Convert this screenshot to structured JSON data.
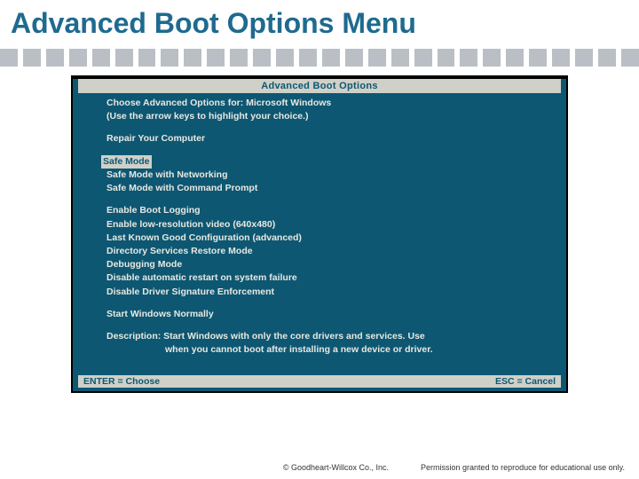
{
  "slide": {
    "title": "Advanced Boot Options Menu"
  },
  "boot": {
    "header": "Advanced Boot Options",
    "choose_line1": "Choose Advanced Options for: Microsoft Windows",
    "choose_line2": "(Use the arrow keys to highlight your choice.)",
    "repair": "Repair Your Computer",
    "opt_safe": "Safe Mode",
    "opt_safe_net": "Safe Mode with Networking",
    "opt_safe_cmd": "Safe Mode with Command Prompt",
    "opt_logging": "Enable Boot Logging",
    "opt_lowres": "Enable low-resolution video (640x480)",
    "opt_lkg": "Last Known Good Configuration (advanced)",
    "opt_dsrm": "Directory Services Restore Mode",
    "opt_debug": "Debugging Mode",
    "opt_norestart": "Disable automatic restart on system failure",
    "opt_nosig": "Disable Driver Signature Enforcement",
    "opt_normal": "Start Windows Normally",
    "desc1": "Description: Start Windows with only the core drivers and services. Use",
    "desc2": "when you cannot boot after installing a new device or driver.",
    "enter": "ENTER = Choose",
    "esc": "ESC = Cancel"
  },
  "footer": {
    "copyright": "© Goodheart-Willcox Co., Inc.",
    "permission": "Permission granted to reproduce for educational use only."
  }
}
